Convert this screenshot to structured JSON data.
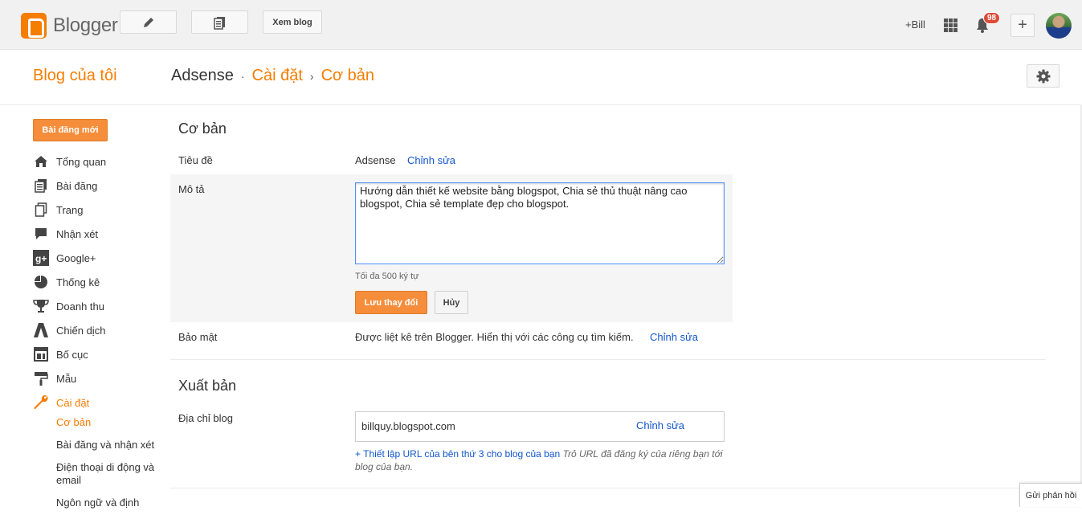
{
  "topbar": {
    "logo_text": "Blogger",
    "view_blog_label": "Xem blog",
    "user_label": "+Bill",
    "notification_count": "98",
    "add_label": "+"
  },
  "header": {
    "my_blogs": "Blog của tôi",
    "breadcrumb": {
      "blog": "Adsense",
      "sep1": "·",
      "section": "Cài đặt",
      "sep2": "›",
      "page": "Cơ bản"
    }
  },
  "sidebar": {
    "new_post_label": "Bài đăng mới",
    "items": [
      {
        "label": "Tổng quan",
        "icon": "home-icon"
      },
      {
        "label": "Bài đăng",
        "icon": "posts-icon"
      },
      {
        "label": "Trang",
        "icon": "pages-icon"
      },
      {
        "label": "Nhận xét",
        "icon": "comment-icon"
      },
      {
        "label": "Google+",
        "icon": "google-plus-icon"
      },
      {
        "label": "Thống kê",
        "icon": "pie-chart-icon"
      },
      {
        "label": "Doanh thu",
        "icon": "trophy-icon"
      },
      {
        "label": "Chiến dịch",
        "icon": "campaign-icon"
      },
      {
        "label": "Bố cục",
        "icon": "layout-icon"
      },
      {
        "label": "Mẫu",
        "icon": "paint-roller-icon"
      },
      {
        "label": "Cài đặt",
        "icon": "wrench-icon"
      }
    ],
    "subitems": [
      {
        "label": "Cơ bản"
      },
      {
        "label": "Bài đăng và nhận xét"
      },
      {
        "label": "Điện thoại di động và email"
      },
      {
        "label": "Ngôn ngữ và định"
      }
    ]
  },
  "basic": {
    "section_title": "Cơ bản",
    "title_label": "Tiêu đề",
    "title_value": "Adsense",
    "edit_label": "Chỉnh sửa",
    "description_label": "Mô tả",
    "description_value": "Hướng dẫn thiết kế website bằng blogspot, Chia sẻ thủ thuật nâng cao blogspot, Chia sẻ template đẹp cho blogspot.",
    "max_hint": "Tối đa 500 ký tự",
    "save_label": "Lưu thay đổi",
    "cancel_label": "Hủy",
    "privacy_label": "Bảo mật",
    "privacy_value": "Được liệt kê trên Blogger. Hiển thị với các công cụ tìm kiếm.",
    "privacy_edit": "Chỉnh sửa"
  },
  "publishing": {
    "section_title": "Xuất bản",
    "address_label": "Địa chỉ blog",
    "address_value": "billquy.blogspot.com",
    "address_edit": "Chỉnh sửa",
    "third_party_link": "+ Thiết lập URL của bên thứ 3 cho blog của bạn",
    "third_party_desc": "Trỏ URL đã đăng ký của riêng bạn tới blog của bạn."
  },
  "feedback_label": "Gửi phản hồi"
}
